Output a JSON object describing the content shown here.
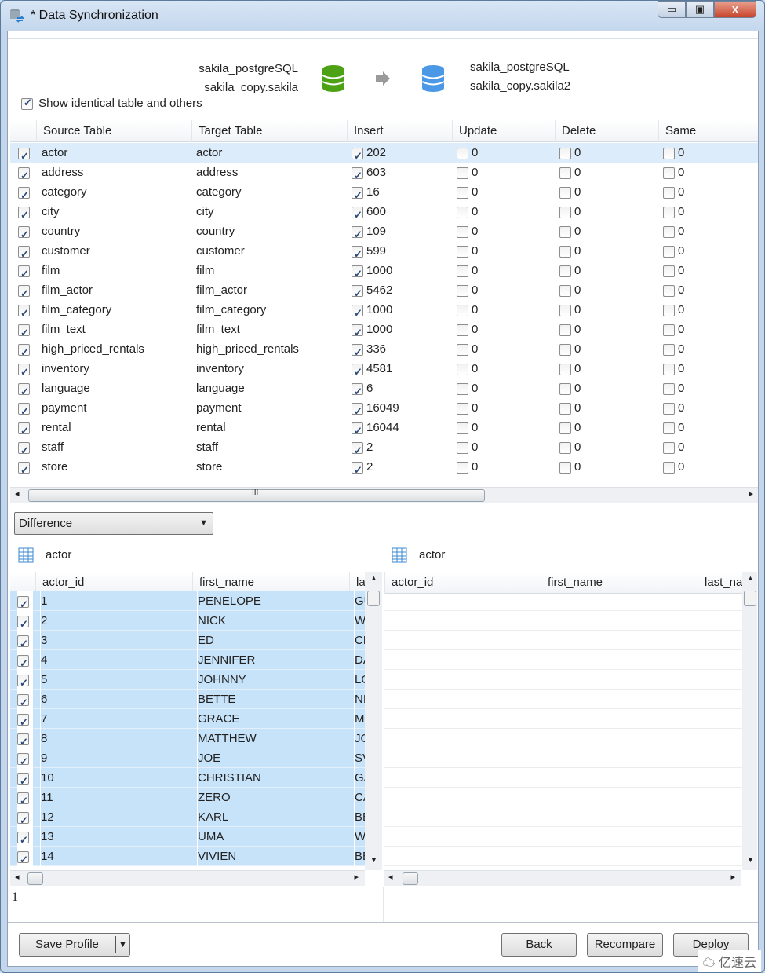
{
  "window": {
    "title": "* Data Synchronization",
    "minimize": "▭",
    "restore": "▣",
    "close": "X"
  },
  "source": {
    "connection": "sakila_postgreSQL",
    "schema": "sakila_copy.sakila",
    "color": "#4ca214"
  },
  "target": {
    "connection": "sakila_postgreSQL",
    "schema": "sakila_copy.sakila2",
    "color": "#4a98e6"
  },
  "show_identical": {
    "label": "Show identical table and others",
    "checked": true
  },
  "table": {
    "columns": [
      "Source Table",
      "Target Table",
      "Insert",
      "Update",
      "Delete",
      "Same"
    ],
    "rows": [
      [
        "actor",
        "actor",
        "202"
      ],
      [
        "address",
        "address",
        "603"
      ],
      [
        "category",
        "category",
        "16"
      ],
      [
        "city",
        "city",
        "600"
      ],
      [
        "country",
        "country",
        "109"
      ],
      [
        "customer",
        "customer",
        "599"
      ],
      [
        "film",
        "film",
        "1000"
      ],
      [
        "film_actor",
        "film_actor",
        "5462"
      ],
      [
        "film_category",
        "film_category",
        "1000"
      ],
      [
        "film_text",
        "film_text",
        "1000"
      ],
      [
        "high_priced_rentals",
        "high_priced_rentals",
        "336"
      ],
      [
        "inventory",
        "inventory",
        "4581"
      ],
      [
        "language",
        "language",
        "6"
      ],
      [
        "payment",
        "payment",
        "16049"
      ],
      [
        "rental",
        "rental",
        "16044"
      ],
      [
        "staff",
        "staff",
        "2"
      ],
      [
        "store",
        "store",
        "2"
      ]
    ],
    "update": "0",
    "delete": "0",
    "same": "0"
  },
  "view_select": {
    "value": "Difference"
  },
  "left_grid": {
    "table": "actor",
    "columns": [
      "actor_id",
      "first_name",
      "la:"
    ],
    "rows": [
      [
        "1",
        "PENELOPE",
        "GU"
      ],
      [
        "2",
        "NICK",
        "W"
      ],
      [
        "3",
        "ED",
        "CH"
      ],
      [
        "4",
        "JENNIFER",
        "DA"
      ],
      [
        "5",
        "JOHNNY",
        "LO"
      ],
      [
        "6",
        "BETTE",
        "NI"
      ],
      [
        "7",
        "GRACE",
        "M"
      ],
      [
        "8",
        "MATTHEW",
        "JO"
      ],
      [
        "9",
        "JOE",
        "SV"
      ],
      [
        "10",
        "CHRISTIAN",
        "GA"
      ],
      [
        "11",
        "ZERO",
        "CA"
      ],
      [
        "12",
        "KARL",
        "BE"
      ],
      [
        "13",
        "UMA",
        "W"
      ],
      [
        "14",
        "VIVIEN",
        "BE"
      ]
    ]
  },
  "right_grid": {
    "table": "actor",
    "columns": [
      "actor_id",
      "first_name",
      "last_nai"
    ]
  },
  "detail_text": "1",
  "buttons": {
    "save_profile": "Save Profile",
    "back": "Back",
    "recompare": "Recompare",
    "deploy": "Deploy"
  },
  "watermark": "亿速云"
}
